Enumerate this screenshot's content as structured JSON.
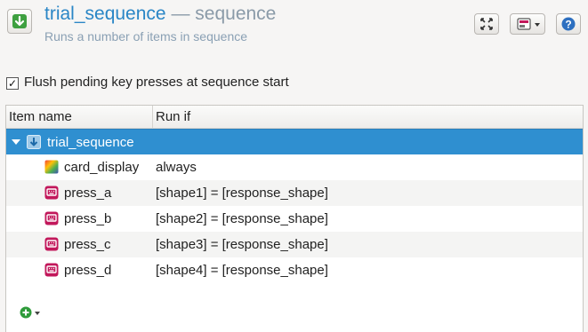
{
  "header": {
    "item_name": "trial_sequence",
    "separator": "—",
    "item_type": "sequence",
    "description": "Runs a number of items in sequence"
  },
  "options": {
    "flush_checked": true,
    "flush_label": "Flush pending key presses at sequence start"
  },
  "tree": {
    "columns": [
      "Item name",
      "Run if"
    ],
    "root": {
      "name": "trial_sequence",
      "run_if": "",
      "icon": "sequence-icon"
    },
    "children": [
      {
        "name": "card_display",
        "run_if": "always",
        "icon": "sketchpad-icon"
      },
      {
        "name": "press_a",
        "run_if": "[shape1] = [response_shape]",
        "icon": "keyboard-response-icon"
      },
      {
        "name": "press_b",
        "run_if": "[shape2] = [response_shape]",
        "icon": "keyboard-response-icon"
      },
      {
        "name": "press_c",
        "run_if": "[shape3] = [response_shape]",
        "icon": "keyboard-response-icon"
      },
      {
        "name": "press_d",
        "run_if": "[shape4] = [response_shape]",
        "icon": "keyboard-response-icon"
      }
    ]
  },
  "colors": {
    "title": "#2a86c6",
    "selection": "#2f8fd0",
    "keyboard_icon": "#c2185b",
    "add_icon": "#2e9b3a"
  }
}
